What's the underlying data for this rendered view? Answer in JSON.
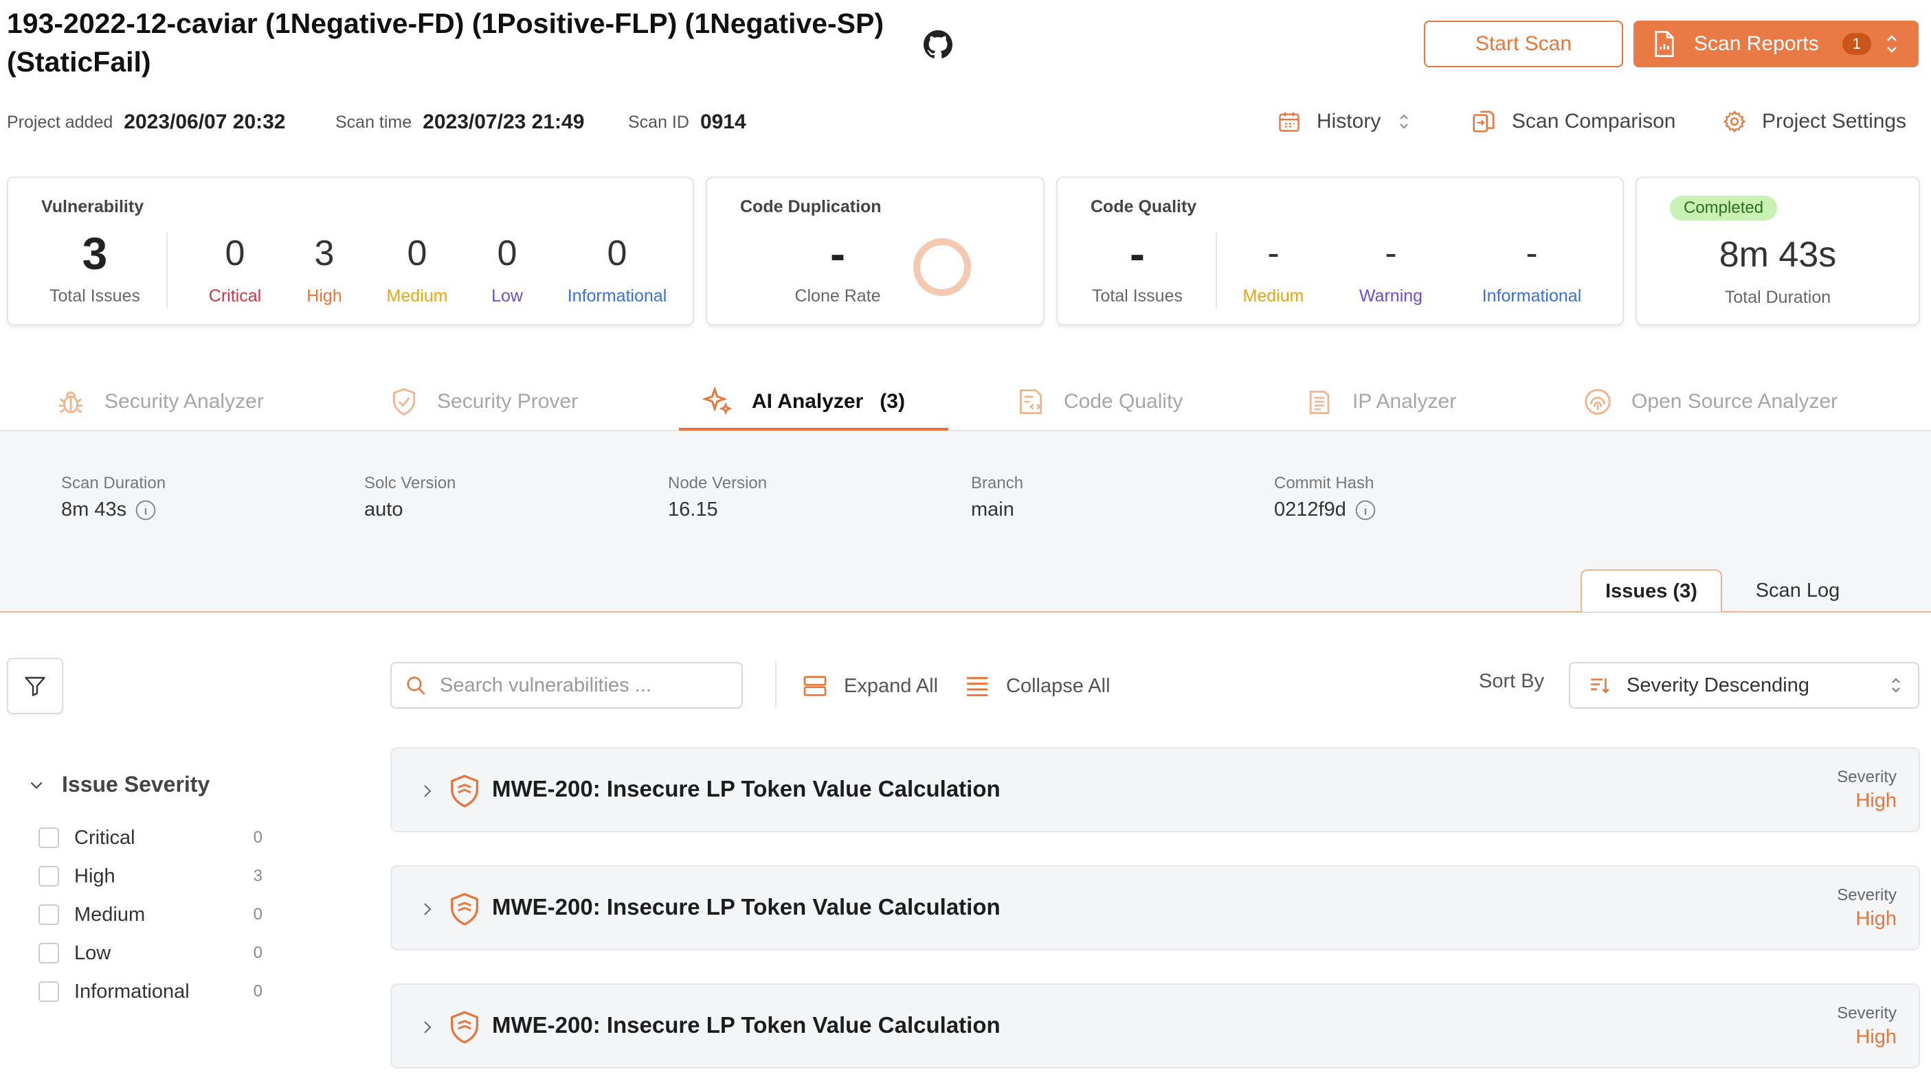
{
  "header": {
    "title": "193-2022-12-caviar (1Negative-FD) (1Positive-FLP) (1Negative-SP) (StaticFail)",
    "start_scan": "Start Scan",
    "scan_reports": "Scan Reports",
    "scan_reports_badge": "1"
  },
  "meta": {
    "project_added_label": "Project added",
    "project_added_value": "2023/06/07 20:32",
    "scan_time_label": "Scan time",
    "scan_time_value": "2023/07/23 21:49",
    "scan_id_label": "Scan ID",
    "scan_id_value": "0914",
    "history": "History",
    "scan_comparison": "Scan Comparison",
    "project_settings": "Project Settings"
  },
  "cards": {
    "vulnerability": {
      "title": "Vulnerability",
      "total": "3",
      "total_label": "Total Issues",
      "critical": "0",
      "critical_label": "Critical",
      "high": "3",
      "high_label": "High",
      "medium": "0",
      "medium_label": "Medium",
      "low": "0",
      "low_label": "Low",
      "informational": "0",
      "informational_label": "Informational"
    },
    "duplication": {
      "title": "Code Duplication",
      "value": "-",
      "label": "Clone Rate"
    },
    "quality": {
      "title": "Code Quality",
      "total": "-",
      "total_label": "Total Issues",
      "medium": "-",
      "medium_label": "Medium",
      "warning": "-",
      "warning_label": "Warning",
      "informational": "-",
      "informational_label": "Informational"
    },
    "duration": {
      "status": "Completed",
      "value": "8m 43s",
      "label": "Total Duration"
    }
  },
  "tabs": [
    {
      "label": "Security Analyzer"
    },
    {
      "label": "Security Prover"
    },
    {
      "label": "AI Analyzer",
      "count": "(3)"
    },
    {
      "label": "Code Quality"
    },
    {
      "label": "IP Analyzer"
    },
    {
      "label": "Open Source Analyzer"
    }
  ],
  "info": {
    "scan_duration_label": "Scan Duration",
    "scan_duration": "8m 43s",
    "solc_label": "Solc Version",
    "solc": "auto",
    "node_label": "Node Version",
    "node": "16.15",
    "branch_label": "Branch",
    "branch": "main",
    "commit_label": "Commit Hash",
    "commit": "0212f9d"
  },
  "subtabs": {
    "issues": "Issues (3)",
    "log": "Scan Log"
  },
  "toolbar": {
    "search_placeholder": "Search vulnerabilities ...",
    "expand_all": "Expand All",
    "collapse_all": "Collapse All",
    "sort_by": "Sort By",
    "sort_value": "Severity Descending"
  },
  "filter": {
    "heading": "Issue Severity",
    "items": [
      {
        "label": "Critical",
        "count": "0"
      },
      {
        "label": "High",
        "count": "3"
      },
      {
        "label": "Medium",
        "count": "0"
      },
      {
        "label": "Low",
        "count": "0"
      },
      {
        "label": "Informational",
        "count": "0"
      }
    ]
  },
  "issues": [
    {
      "title": "MWE-200: Insecure LP Token Value Calculation",
      "severity_label": "Severity",
      "severity": "High"
    },
    {
      "title": "MWE-200: Insecure LP Token Value Calculation",
      "severity_label": "Severity",
      "severity": "High"
    },
    {
      "title": "MWE-200: Insecure LP Token Value Calculation",
      "severity_label": "Severity",
      "severity": "High"
    }
  ],
  "colors": {
    "accent": "#e8763c",
    "critical": "#d0353f",
    "high": "#e8763c",
    "medium": "#e6a615",
    "low": "#6a4fd1",
    "informational": "#3b6fdd",
    "completed_bg": "#c9f1b3"
  }
}
